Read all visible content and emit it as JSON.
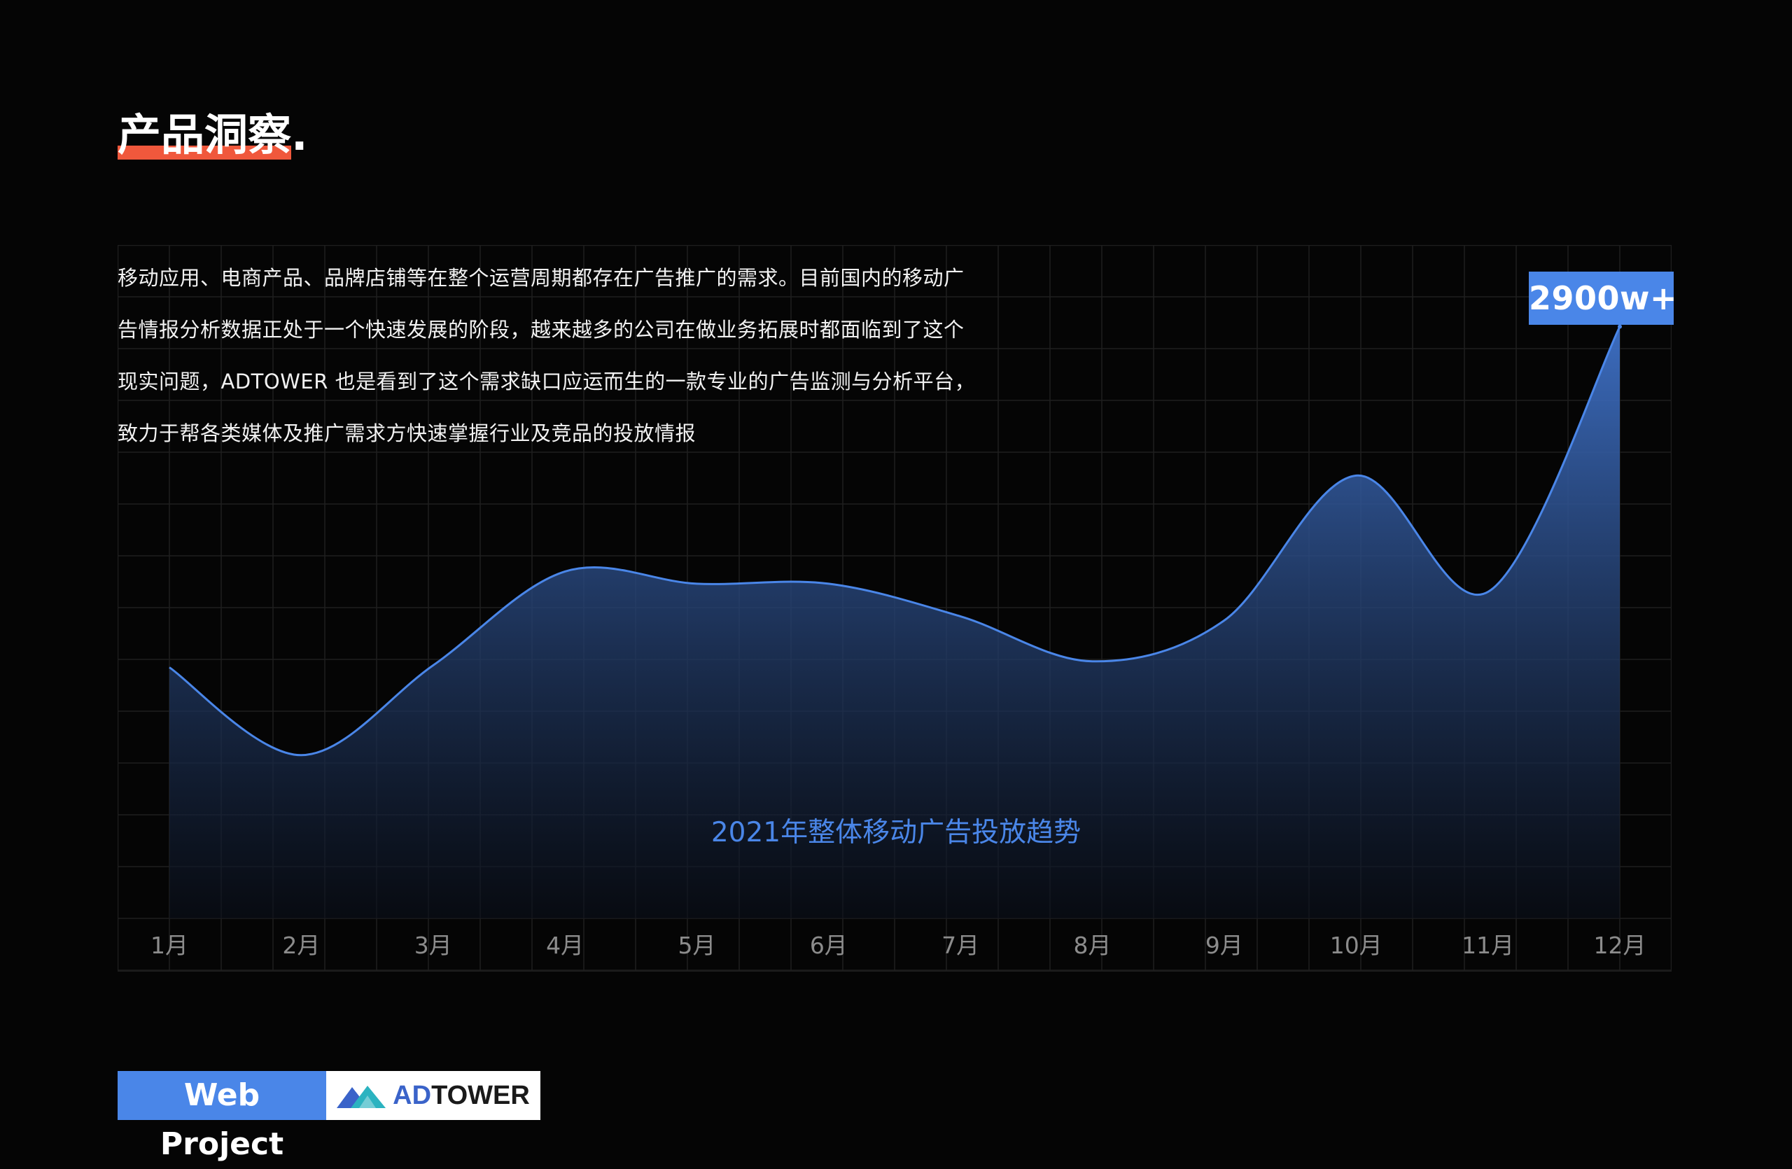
{
  "page": {
    "title": "产品洞察",
    "title_suffix": ".",
    "intro_lines": [
      "移动应用、电商产品、品牌店铺等在整个运营周期都存在广告推广的需求。目前国内的移动广",
      "告情报分析数据正处于一个快速发展的阶段，越来越多的公司在做业务拓展时都面临到了这个",
      "现实问题，ADTOWER 也是看到了这个需求缺口应运而生的一款专业的广告监测与分析平台，",
      "致力于帮各类媒体及推广需求方快速掌握行业及竞品的投放情报"
    ]
  },
  "chart_data": {
    "type": "area",
    "title": "2021年整体移动广告投放趋势",
    "categories": [
      "1月",
      "2月",
      "3月",
      "4月",
      "5月",
      "6月",
      "7月",
      "8月",
      "9月",
      "10月",
      "11月",
      "12月"
    ],
    "series": [
      {
        "values": [
          1230,
          800,
          1240,
          1700,
          1640,
          1640,
          1480,
          1260,
          1460,
          2170,
          1600,
          2900
        ]
      }
    ],
    "peak_label": "2900w+",
    "ylim": [
      0,
      3300
    ],
    "grid": true,
    "colors": {
      "line": "#4a86e8",
      "fill_top": "#3f72c9",
      "fill_bottom": "#0a0f1a",
      "grid": "#1f1f1f",
      "tick_label": "#8c8c8c"
    }
  },
  "footer": {
    "project_label": "Web Project",
    "brand_prefix": "AD",
    "brand_suffix": "TOWER",
    "brand_logo": "mountain-logo-icon"
  }
}
